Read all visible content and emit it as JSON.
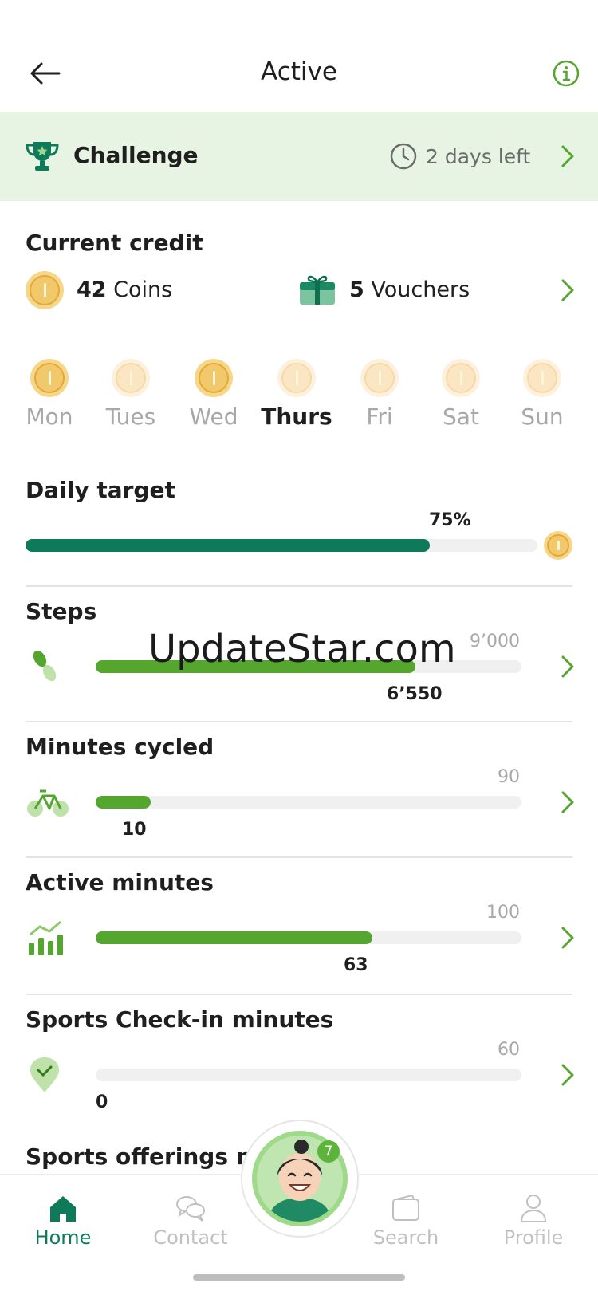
{
  "header": {
    "title": "Active"
  },
  "challenge": {
    "label": "Challenge",
    "time_left": "2 days left"
  },
  "credit": {
    "title": "Current credit",
    "coins_count": "42",
    "coins_label": "Coins",
    "vouchers_count": "5",
    "vouchers_label": "Vouchers"
  },
  "week": [
    {
      "label": "Mon",
      "earned": true
    },
    {
      "label": "Tues",
      "earned": false
    },
    {
      "label": "Wed",
      "earned": true
    },
    {
      "label": "Thurs",
      "earned": false,
      "today": true
    },
    {
      "label": "Fri",
      "earned": false
    },
    {
      "label": "Sat",
      "earned": false
    },
    {
      "label": "Sun",
      "earned": false
    }
  ],
  "daily_target": {
    "title": "Daily target",
    "percent_label": "75%",
    "progress": 0.79
  },
  "metrics": [
    {
      "title": "Steps",
      "target": "9’000",
      "current": "6’550",
      "progress": 0.75,
      "icon": "footsteps-icon"
    },
    {
      "title": "Minutes cycled",
      "target": "90",
      "current": "10",
      "progress": 0.13,
      "icon": "bicycle-icon"
    },
    {
      "title": "Active minutes",
      "target": "100",
      "current": "63",
      "progress": 0.65,
      "icon": "activity-chart-icon"
    },
    {
      "title": "Sports Check-in minutes",
      "target": "60",
      "current": "0",
      "progress": 0.0,
      "icon": "location-check-icon"
    }
  ],
  "offerings": {
    "title": "Sports offerings nea"
  },
  "watermark": "UpdateStar.com",
  "nav": {
    "items": [
      {
        "label": "Home",
        "icon": "home-icon",
        "active": true
      },
      {
        "label": "Contact",
        "icon": "chat-icon",
        "active": false
      },
      {
        "label": "Search",
        "icon": "wallet-icon",
        "active": false
      },
      {
        "label": "Profile",
        "icon": "person-icon",
        "active": false
      }
    ],
    "avatar_badge": "7"
  },
  "colors": {
    "accent": "#0f7a5a",
    "green": "#55a62f",
    "challenge_bg": "#e7f4e3",
    "coin": "#f2c96a"
  }
}
